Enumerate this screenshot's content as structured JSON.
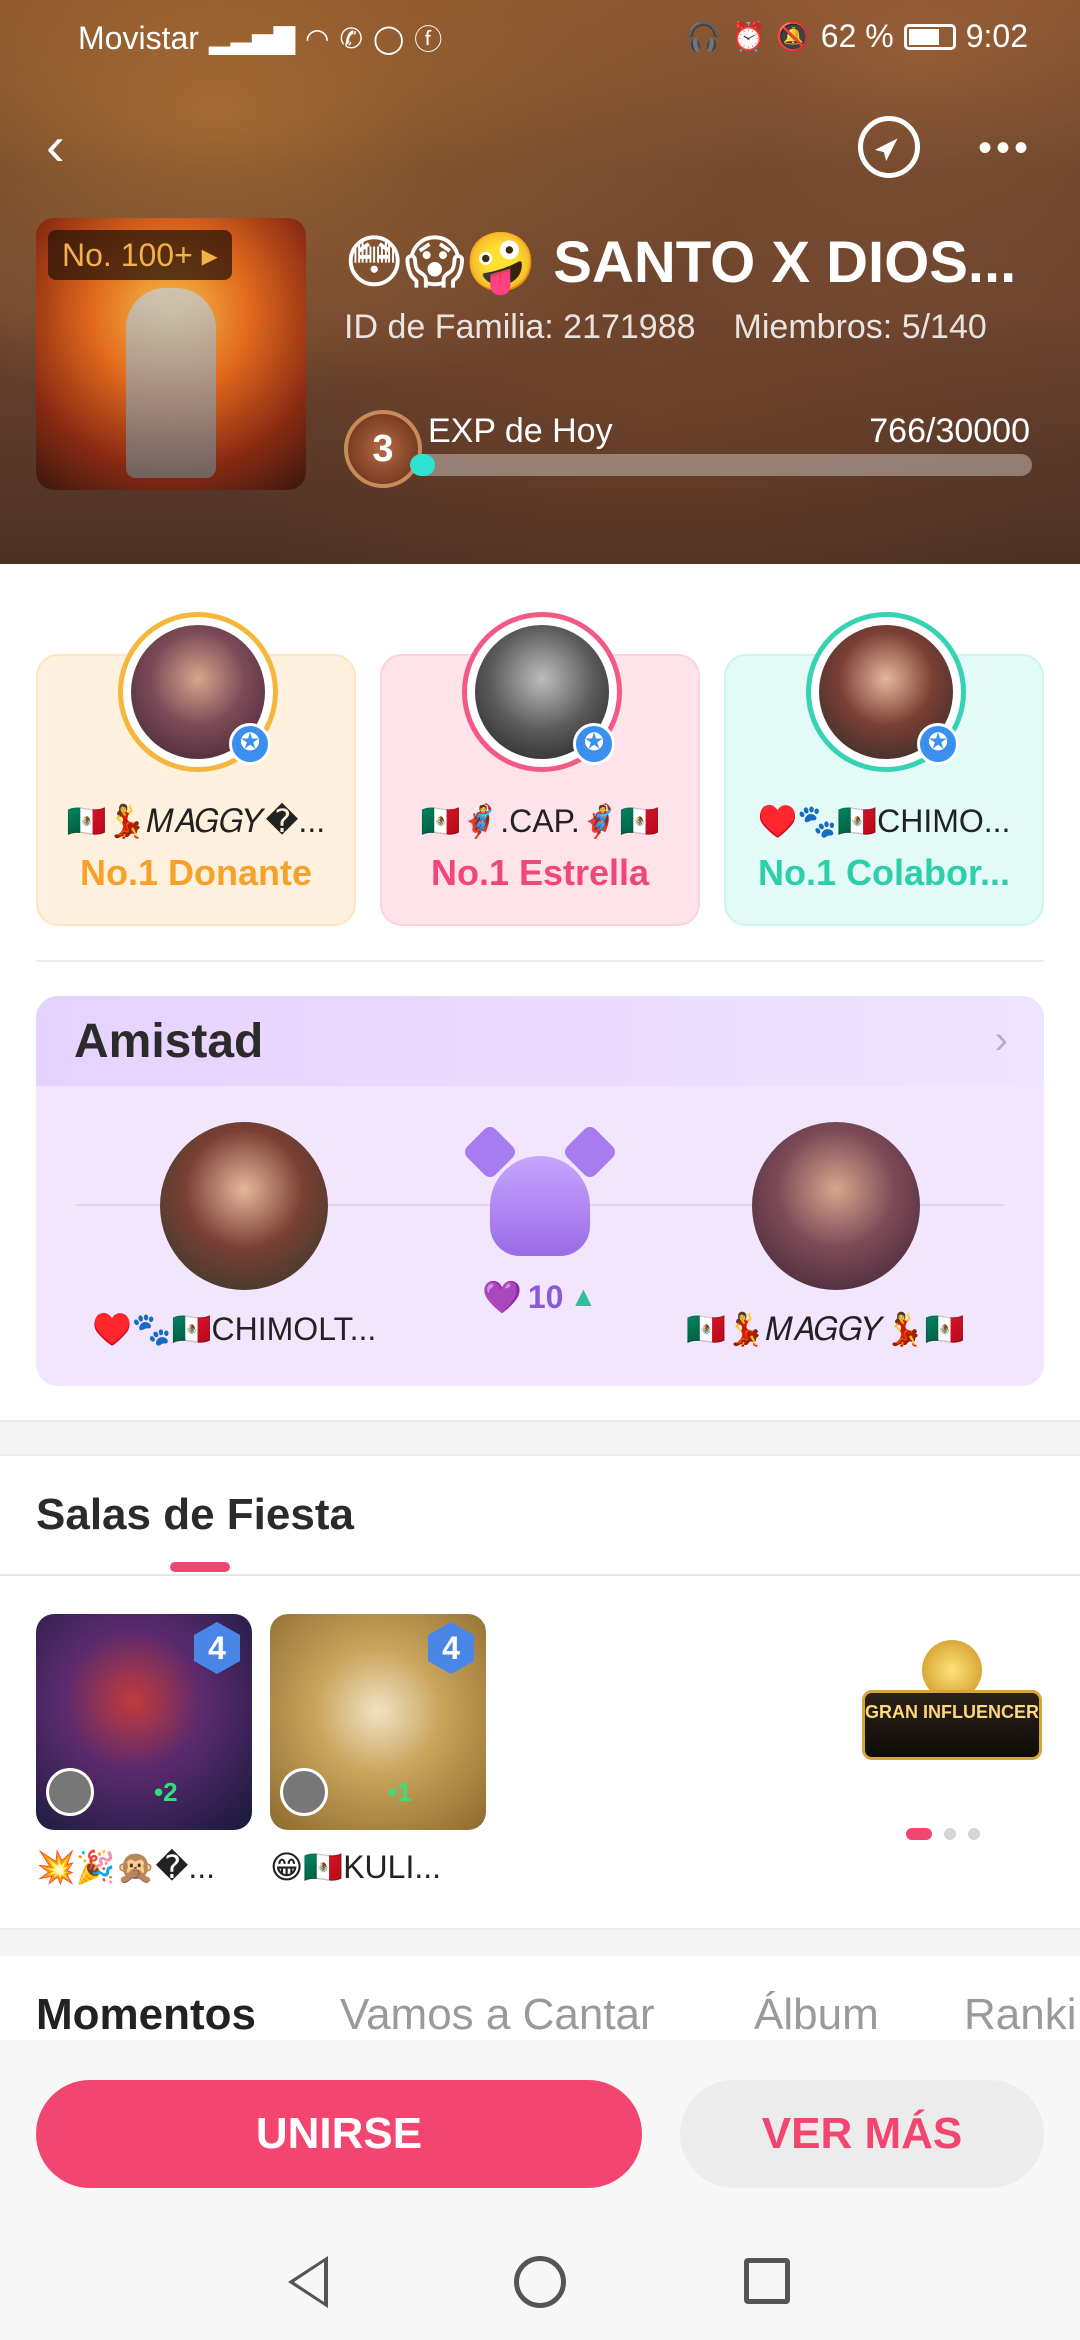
{
  "status_bar": {
    "carrier": "Movistar",
    "battery": "62 %",
    "time": "9:02"
  },
  "header": {
    "rank_badge": "No. 100+",
    "family_name": "😳😱🤪 SANTO X DIOS...",
    "family_id": "ID de Familia: 2171988",
    "members": "Miembros: 5/140",
    "level": "3",
    "exp_label": "EXP de Hoy",
    "exp_value": "766/30000",
    "exp_fraction": 0.0255
  },
  "top_members": [
    {
      "name": "🇲🇽💃𝑀𝐴𝐺𝐺𝑌�...",
      "role": "No.1 Donante"
    },
    {
      "name": "🇲🇽🦸.CAP.🦸🇲🇽",
      "role": "No.1 Estrella"
    },
    {
      "name": "♥️🐾🇲🇽CHIMO...",
      "role": "No.1 Colabor..."
    }
  ],
  "amistad": {
    "title": "Amistad",
    "left_name": "♥️🐾🇲🇽CHIMOLT...",
    "right_name": "🇲🇽💃𝑀𝐴𝐺𝐺𝑌💃🇲🇽",
    "score": "10"
  },
  "salas": {
    "title": "Salas de Fiesta",
    "rooms": [
      {
        "name": "💥🎉🙊�...",
        "level": "4",
        "count": "•2"
      },
      {
        "name": "😁🇲🇽KULI...",
        "level": "4",
        "count": "•1"
      }
    ],
    "banner": "GRAN INFLUENCER"
  },
  "tabs": [
    "Momentos",
    "Vamos a Cantar",
    "Álbum",
    "Ranki"
  ],
  "actions": {
    "join": "UNIRSE",
    "more": "VER MÁS"
  },
  "colors": {
    "accent": "#f2456f",
    "donante": "#f5a12a",
    "estrella": "#f0467a",
    "colaborador": "#2ccfaa",
    "amistad_bg": "#f2e6ff"
  }
}
